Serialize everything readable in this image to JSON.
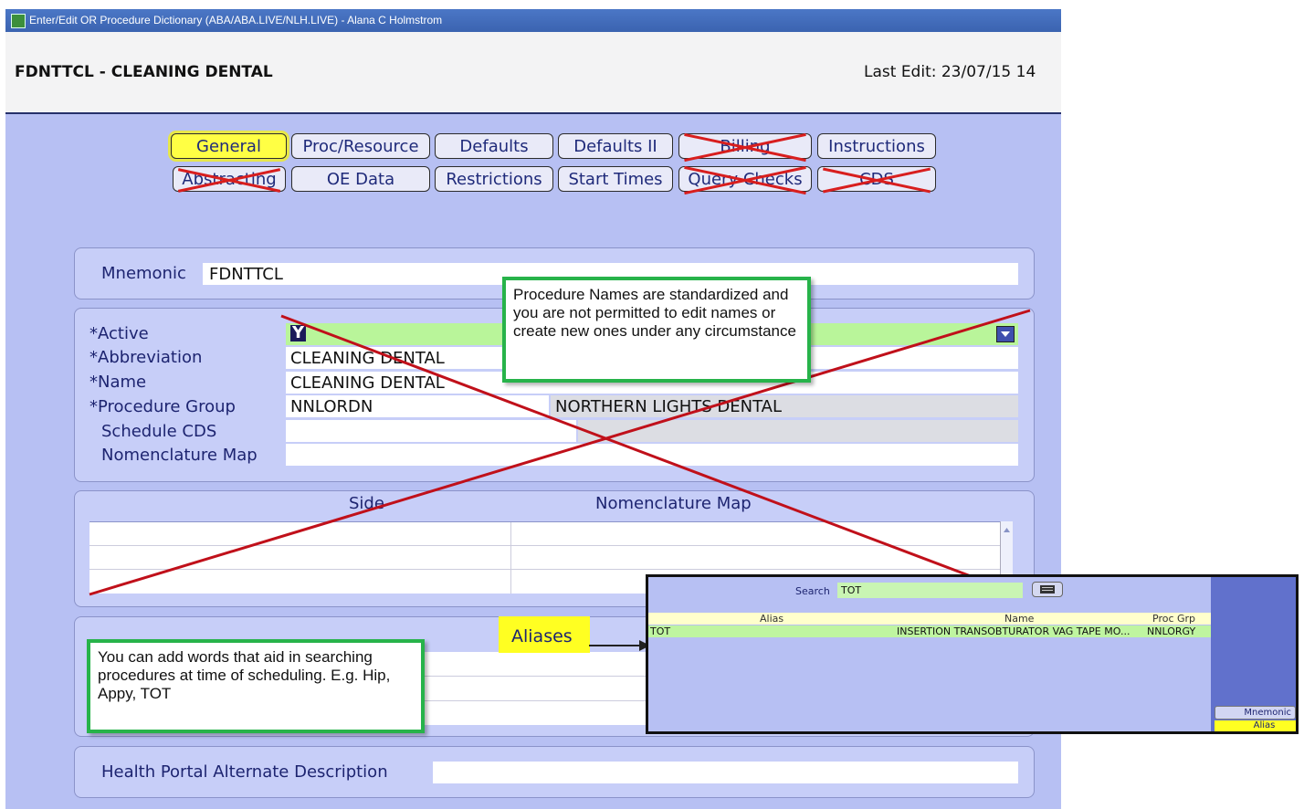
{
  "window": {
    "title": "Enter/Edit OR Procedure Dictionary (ABA/ABA.LIVE/NLH.LIVE) - Alana C Holmstrom"
  },
  "header": {
    "title": "FDNTTCL - CLEANING DENTAL",
    "last_edit": "Last Edit: 23/07/15 14"
  },
  "tabs_row1": [
    "General",
    "Proc/Resource",
    "Defaults",
    "Defaults II",
    "Billing",
    "Instructions"
  ],
  "tabs_row2": [
    "Abstracting",
    "OE Data",
    "Restrictions",
    "Start Times",
    "Query Checks",
    "CDS"
  ],
  "mnemonic": {
    "label": "Mnemonic",
    "value": "FDNTTCL"
  },
  "fields": {
    "active": {
      "label": "*Active",
      "value": "Y"
    },
    "abbreviation": {
      "label": "*Abbreviation",
      "value": "CLEANING DENTAL"
    },
    "name": {
      "label": "*Name",
      "value": "CLEANING DENTAL"
    },
    "procedure_group": {
      "label": "*Procedure Group",
      "value": "NNLORDN",
      "description": "NORTHERN LIGHTS DENTAL"
    },
    "schedule_cds": {
      "label": "Schedule CDS",
      "value": ""
    },
    "nomenclature_map": {
      "label": "Nomenclature Map",
      "value": ""
    }
  },
  "side_table": {
    "headers": [
      "Side",
      "Nomenclature Map"
    ]
  },
  "aliases": {
    "label": "Aliases"
  },
  "health_portal": {
    "label": "Health Portal Alternate Description",
    "value": ""
  },
  "callouts": {
    "procedure_names": "Procedure Names are standardized and you are not permitted to edit names or create new ones under any circumstance",
    "aliases_help": "You can add words that aid in searching procedures at time of scheduling. E.g. Hip, Appy, TOT"
  },
  "search_popup": {
    "search_label": "Search",
    "search_value": "TOT",
    "columns": [
      "Alias",
      "Name",
      "Proc Grp"
    ],
    "rows": [
      {
        "alias": "TOT",
        "name": "INSERTION TRANSOBTURATOR VAG TAPE MO...",
        "proc_grp": "NNLORGY"
      }
    ],
    "side_buttons": [
      "Mnemonic",
      "Alias"
    ]
  },
  "colors": {
    "window_bg": "#b7c0f3",
    "selected_tab": "#ffff44",
    "callout_border": "#27b34a",
    "strike": "#c0101a"
  }
}
